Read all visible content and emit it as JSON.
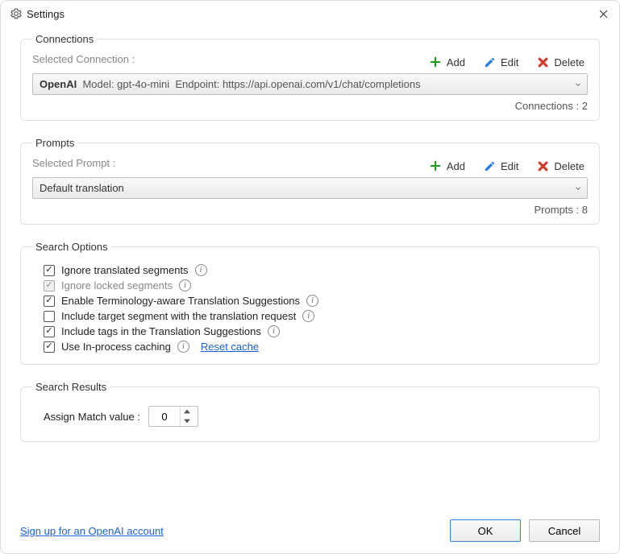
{
  "titlebar": {
    "title": "Settings"
  },
  "connections": {
    "legend": "Connections",
    "selected_label": "Selected Connection :",
    "add": "Add",
    "edit": "Edit",
    "delete": "Delete",
    "dropdown_provider": "OpenAI",
    "dropdown_model_label": "Model:",
    "dropdown_model": "gpt-4o-mini",
    "dropdown_endpoint_label": "Endpoint:",
    "dropdown_endpoint": "https://api.openai.com/v1/chat/completions",
    "count_label": "Connections :",
    "count": "2"
  },
  "prompts": {
    "legend": "Prompts",
    "selected_label": "Selected Prompt :",
    "add": "Add",
    "edit": "Edit",
    "delete": "Delete",
    "dropdown_value": "Default translation",
    "count_label": "Prompts :",
    "count": "8"
  },
  "search_options": {
    "legend": "Search Options",
    "opt1": "Ignore translated segments",
    "opt2": "Ignore locked segments",
    "opt3": "Enable Terminology-aware Translation Suggestions",
    "opt4": "Include target segment with the translation request",
    "opt5": "Include tags in the Translation Suggestions",
    "opt6": "Use In-process caching",
    "reset_cache": "Reset cache"
  },
  "search_results": {
    "legend": "Search Results",
    "assign_label": "Assign Match value :",
    "assign_value": "0"
  },
  "footer": {
    "signup_link": "Sign up for an OpenAI account",
    "ok": "OK",
    "cancel": "Cancel"
  },
  "icons": {
    "info_char": "i"
  }
}
